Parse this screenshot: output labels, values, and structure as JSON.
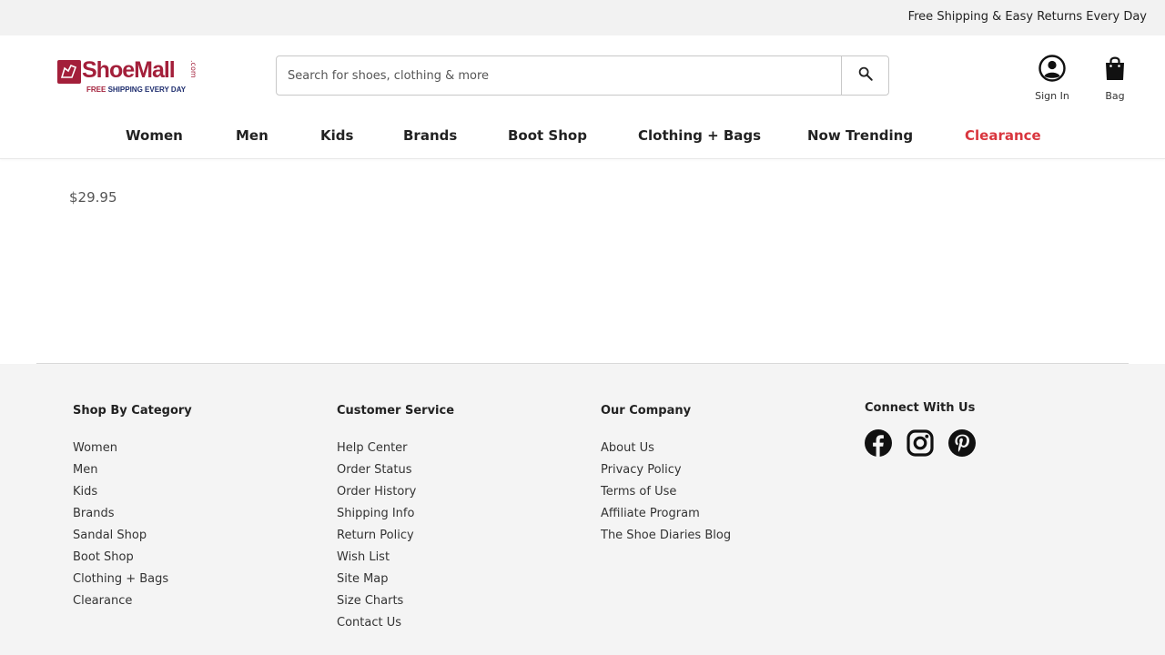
{
  "promo": {
    "text": "Free Shipping & Easy Returns Every Day"
  },
  "logo": {
    "name": "ShoeMall",
    "com": ".com",
    "tagline_free": "FREE",
    "tagline_rest": " SHIPPING EVERY DAY"
  },
  "search": {
    "placeholder": "Search for shoes, clothing & more",
    "icon": "search-icon"
  },
  "header": {
    "sign_in": "Sign In",
    "bag": "Bag"
  },
  "nav": {
    "items": [
      "Women",
      "Men",
      "Kids",
      "Brands",
      "Boot Shop",
      "Clothing + Bags",
      "Now Trending",
      "Clearance"
    ],
    "highlight_color": "#d9363e"
  },
  "product": {
    "price": "$29.95"
  },
  "footer": {
    "shop": {
      "heading": "Shop By Category",
      "links": [
        "Women",
        "Men",
        "Kids",
        "Brands",
        "Sandal Shop",
        "Boot Shop",
        "Clothing + Bags",
        "Clearance"
      ]
    },
    "service": {
      "heading": "Customer Service",
      "links": [
        "Help Center",
        "Order Status",
        "Order History",
        "Shipping Info",
        "Return Policy",
        "Wish List",
        "Site Map",
        "Size Charts",
        "Contact Us"
      ]
    },
    "company": {
      "heading": "Our Company",
      "links": [
        "About Us",
        "Privacy Policy",
        "Terms of Use",
        "Affiliate Program",
        "The Shoe Diaries Blog"
      ]
    },
    "connect": {
      "heading": "Connect With Us",
      "icons": [
        "facebook-icon",
        "instagram-icon",
        "pinterest-icon"
      ]
    }
  },
  "colors": {
    "brand": "#a31f3a",
    "clearance": "#d9363e",
    "footer_bg": "#f4f4f4"
  }
}
